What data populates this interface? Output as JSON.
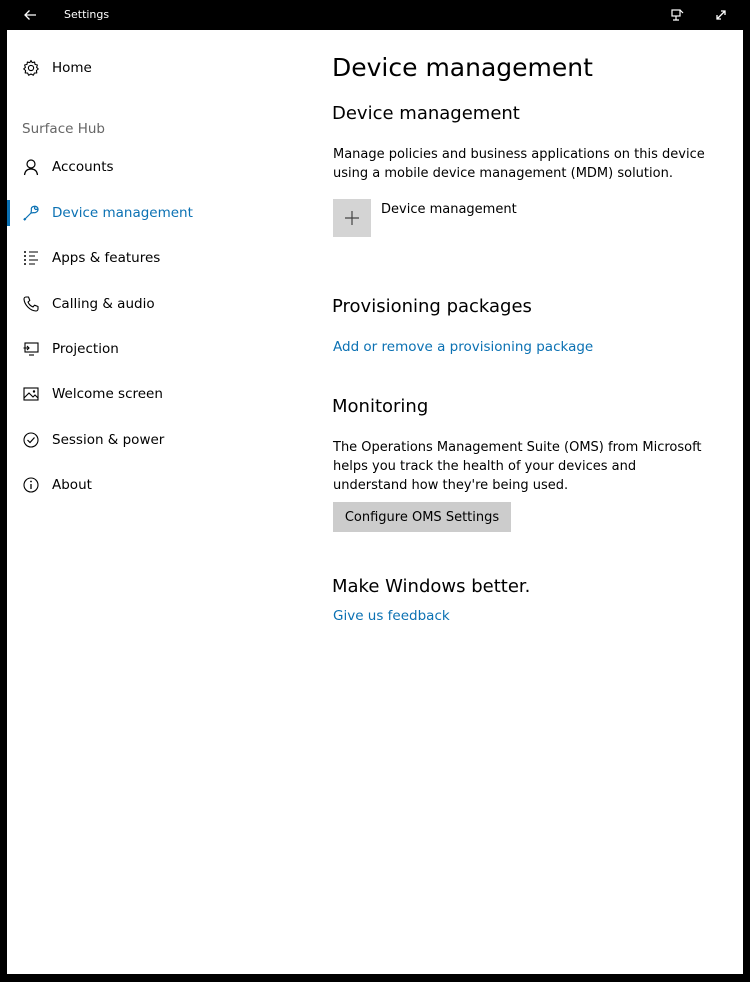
{
  "titlebar": {
    "title": "Settings"
  },
  "sidebar": {
    "home_label": "Home",
    "section_label": "Surface Hub",
    "items": [
      {
        "label": "Accounts",
        "icon": "person-icon"
      },
      {
        "label": "Device management",
        "icon": "wrench-icon",
        "active": true
      },
      {
        "label": "Apps & features",
        "icon": "list-icon"
      },
      {
        "label": "Calling & audio",
        "icon": "phone-icon"
      },
      {
        "label": "Projection",
        "icon": "projection-icon"
      },
      {
        "label": "Welcome screen",
        "icon": "picture-icon"
      },
      {
        "label": "Session & power",
        "icon": "check-circle-icon"
      },
      {
        "label": "About",
        "icon": "info-icon"
      }
    ]
  },
  "content": {
    "page_title": "Device management",
    "device_management": {
      "heading": "Device management",
      "description": "Manage policies and business applications on this device using a mobile device management (MDM) solution.",
      "add_label": "Device management"
    },
    "provisioning": {
      "heading": "Provisioning packages",
      "link": "Add or remove a provisioning package"
    },
    "monitoring": {
      "heading": "Monitoring",
      "description": "The Operations Management Suite (OMS) from Microsoft helps you track the health of your devices and understand how they're being used.",
      "button": "Configure OMS Settings"
    },
    "feedback": {
      "heading": "Make Windows better.",
      "link": "Give us feedback"
    }
  },
  "colors": {
    "accent": "#0b71b3",
    "titlebar": "#000000",
    "button_bg": "#cccccc",
    "tile_bg": "#d4d4d4"
  }
}
